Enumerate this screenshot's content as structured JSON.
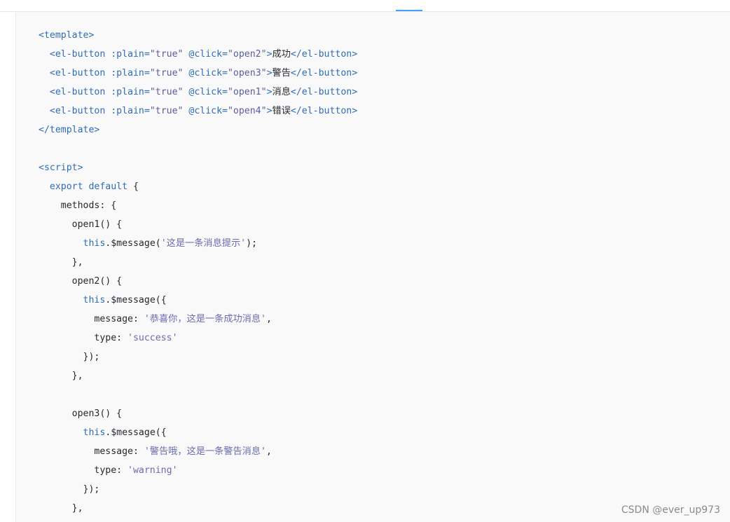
{
  "code_lines": [
    [
      {
        "t": "tag",
        "v": "<template>"
      }
    ],
    [
      {
        "t": "plain",
        "v": "  "
      },
      {
        "t": "tag",
        "v": "<el-button "
      },
      {
        "t": "attr",
        "v": ":plain="
      },
      {
        "t": "val",
        "v": "\"true\""
      },
      {
        "t": "plain",
        "v": " "
      },
      {
        "t": "attr",
        "v": "@click="
      },
      {
        "t": "val",
        "v": "\"open2\""
      },
      {
        "t": "tag",
        "v": ">"
      },
      {
        "t": "plain",
        "v": "成功"
      },
      {
        "t": "tag",
        "v": "</el-button>"
      }
    ],
    [
      {
        "t": "plain",
        "v": "  "
      },
      {
        "t": "tag",
        "v": "<el-button "
      },
      {
        "t": "attr",
        "v": ":plain="
      },
      {
        "t": "val",
        "v": "\"true\""
      },
      {
        "t": "plain",
        "v": " "
      },
      {
        "t": "attr",
        "v": "@click="
      },
      {
        "t": "val",
        "v": "\"open3\""
      },
      {
        "t": "tag",
        "v": ">"
      },
      {
        "t": "plain",
        "v": "警告"
      },
      {
        "t": "tag",
        "v": "</el-button>"
      }
    ],
    [
      {
        "t": "plain",
        "v": "  "
      },
      {
        "t": "tag",
        "v": "<el-button "
      },
      {
        "t": "attr",
        "v": ":plain="
      },
      {
        "t": "val",
        "v": "\"true\""
      },
      {
        "t": "plain",
        "v": " "
      },
      {
        "t": "attr",
        "v": "@click="
      },
      {
        "t": "val",
        "v": "\"open1\""
      },
      {
        "t": "tag",
        "v": ">"
      },
      {
        "t": "plain",
        "v": "消息"
      },
      {
        "t": "tag",
        "v": "</el-button>"
      }
    ],
    [
      {
        "t": "plain",
        "v": "  "
      },
      {
        "t": "tag",
        "v": "<el-button "
      },
      {
        "t": "attr",
        "v": ":plain="
      },
      {
        "t": "val",
        "v": "\"true\""
      },
      {
        "t": "plain",
        "v": " "
      },
      {
        "t": "attr",
        "v": "@click="
      },
      {
        "t": "val",
        "v": "\"open4\""
      },
      {
        "t": "tag",
        "v": ">"
      },
      {
        "t": "plain",
        "v": "错误"
      },
      {
        "t": "tag",
        "v": "</el-button>"
      }
    ],
    [
      {
        "t": "tag",
        "v": "</template>"
      }
    ],
    [],
    [
      {
        "t": "tag",
        "v": "<script>"
      }
    ],
    [
      {
        "t": "plain",
        "v": "  "
      },
      {
        "t": "kw",
        "v": "export default"
      },
      {
        "t": "plain",
        "v": " {"
      }
    ],
    [
      {
        "t": "plain",
        "v": "    methods: {"
      }
    ],
    [
      {
        "t": "plain",
        "v": "      open1() {"
      }
    ],
    [
      {
        "t": "plain",
        "v": "        "
      },
      {
        "t": "kw",
        "v": "this"
      },
      {
        "t": "plain",
        "v": ".$message("
      },
      {
        "t": "str",
        "v": "'这是一条消息提示'"
      },
      {
        "t": "plain",
        "v": ");"
      }
    ],
    [
      {
        "t": "plain",
        "v": "      },"
      }
    ],
    [
      {
        "t": "plain",
        "v": "      open2() {"
      }
    ],
    [
      {
        "t": "plain",
        "v": "        "
      },
      {
        "t": "kw",
        "v": "this"
      },
      {
        "t": "plain",
        "v": ".$message({"
      }
    ],
    [
      {
        "t": "plain",
        "v": "          message: "
      },
      {
        "t": "str",
        "v": "'恭喜你，这是一条成功消息'"
      },
      {
        "t": "plain",
        "v": ","
      }
    ],
    [
      {
        "t": "plain",
        "v": "          type: "
      },
      {
        "t": "str",
        "v": "'success'"
      }
    ],
    [
      {
        "t": "plain",
        "v": "        });"
      }
    ],
    [
      {
        "t": "plain",
        "v": "      },"
      }
    ],
    [],
    [
      {
        "t": "plain",
        "v": "      open3() {"
      }
    ],
    [
      {
        "t": "plain",
        "v": "        "
      },
      {
        "t": "kw",
        "v": "this"
      },
      {
        "t": "plain",
        "v": ".$message({"
      }
    ],
    [
      {
        "t": "plain",
        "v": "          message: "
      },
      {
        "t": "str",
        "v": "'警告哦，这是一条警告消息'"
      },
      {
        "t": "plain",
        "v": ","
      }
    ],
    [
      {
        "t": "plain",
        "v": "          type: "
      },
      {
        "t": "str",
        "v": "'warning'"
      }
    ],
    [
      {
        "t": "plain",
        "v": "        });"
      }
    ],
    [
      {
        "t": "plain",
        "v": "      },"
      }
    ]
  ],
  "watermark": "CSDN @ever_up973"
}
